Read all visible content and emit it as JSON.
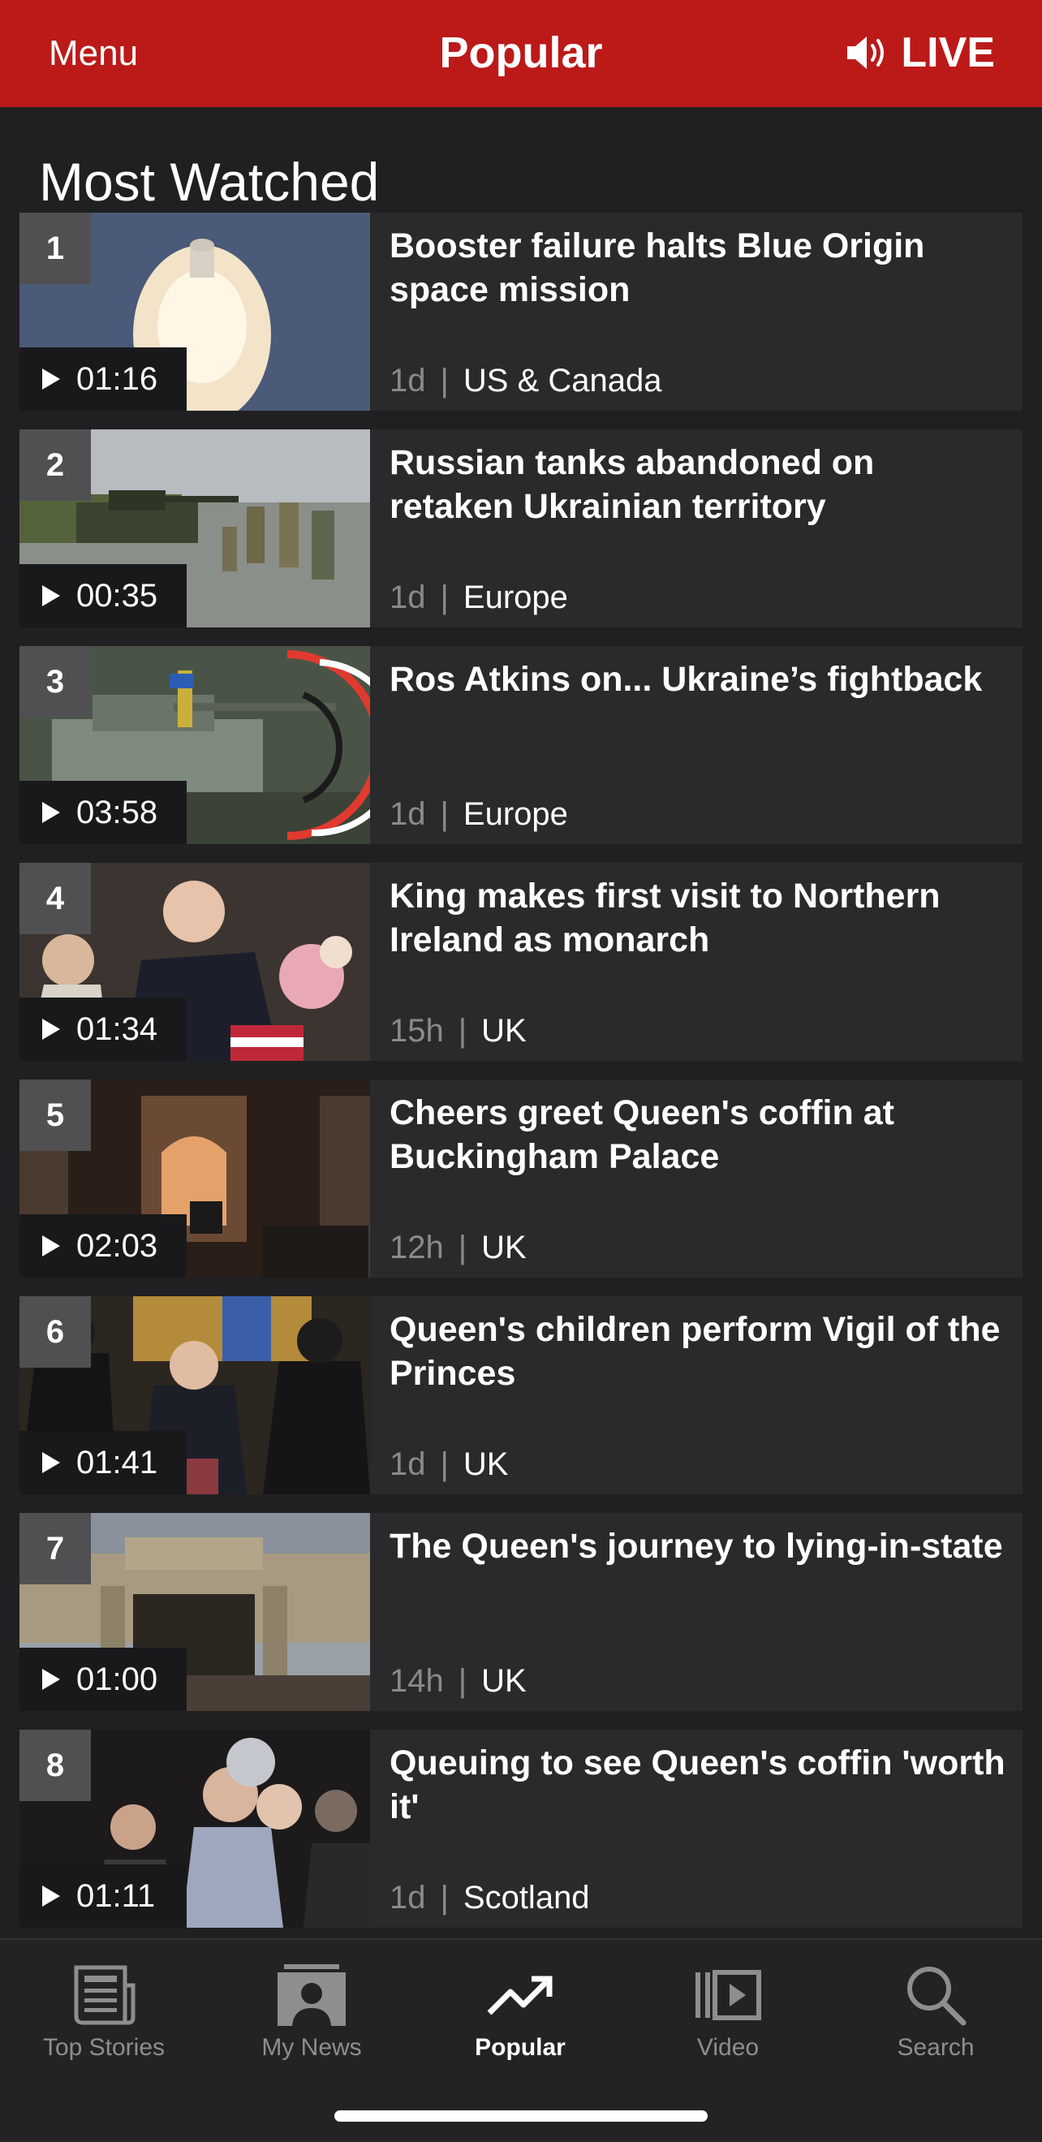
{
  "header": {
    "menu_label": "Menu",
    "title": "Popular",
    "live_label": "LIVE",
    "color": "#bb1a19"
  },
  "section": {
    "title": "Most Watched"
  },
  "items": [
    {
      "rank": "1",
      "duration": "01:16",
      "headline": "Booster failure halts Blue Origin space mission",
      "age": "1d",
      "category": "US & Canada"
    },
    {
      "rank": "2",
      "duration": "00:35",
      "headline": "Russian tanks abandoned on retaken Ukrainian territory",
      "age": "1d",
      "category": "Europe"
    },
    {
      "rank": "3",
      "duration": "03:58",
      "headline": "Ros Atkins on... Ukraine’s fightback",
      "age": "1d",
      "category": "Europe"
    },
    {
      "rank": "4",
      "duration": "01:34",
      "headline": "King makes first visit to Northern Ireland as monarch",
      "age": "15h",
      "category": "UK"
    },
    {
      "rank": "5",
      "duration": "02:03",
      "headline": "Cheers greet Queen's coffin at Buckingham Palace",
      "age": "12h",
      "category": "UK"
    },
    {
      "rank": "6",
      "duration": "01:41",
      "headline": "Queen's children perform Vigil of the Princes",
      "age": "1d",
      "category": "UK"
    },
    {
      "rank": "7",
      "duration": "01:00",
      "headline": "The Queen's journey to lying-in-state",
      "age": "14h",
      "category": "UK"
    },
    {
      "rank": "8",
      "duration": "01:11",
      "headline": "Queuing to see Queen's coffin 'worth it'",
      "age": "1d",
      "category": "Scotland"
    }
  ],
  "tabs": [
    {
      "label": "Top Stories",
      "icon": "newspaper-icon"
    },
    {
      "label": "My News",
      "icon": "person-icon"
    },
    {
      "label": "Popular",
      "icon": "trending-icon",
      "active": true
    },
    {
      "label": "Video",
      "icon": "video-icon"
    },
    {
      "label": "Search",
      "icon": "search-icon"
    }
  ]
}
